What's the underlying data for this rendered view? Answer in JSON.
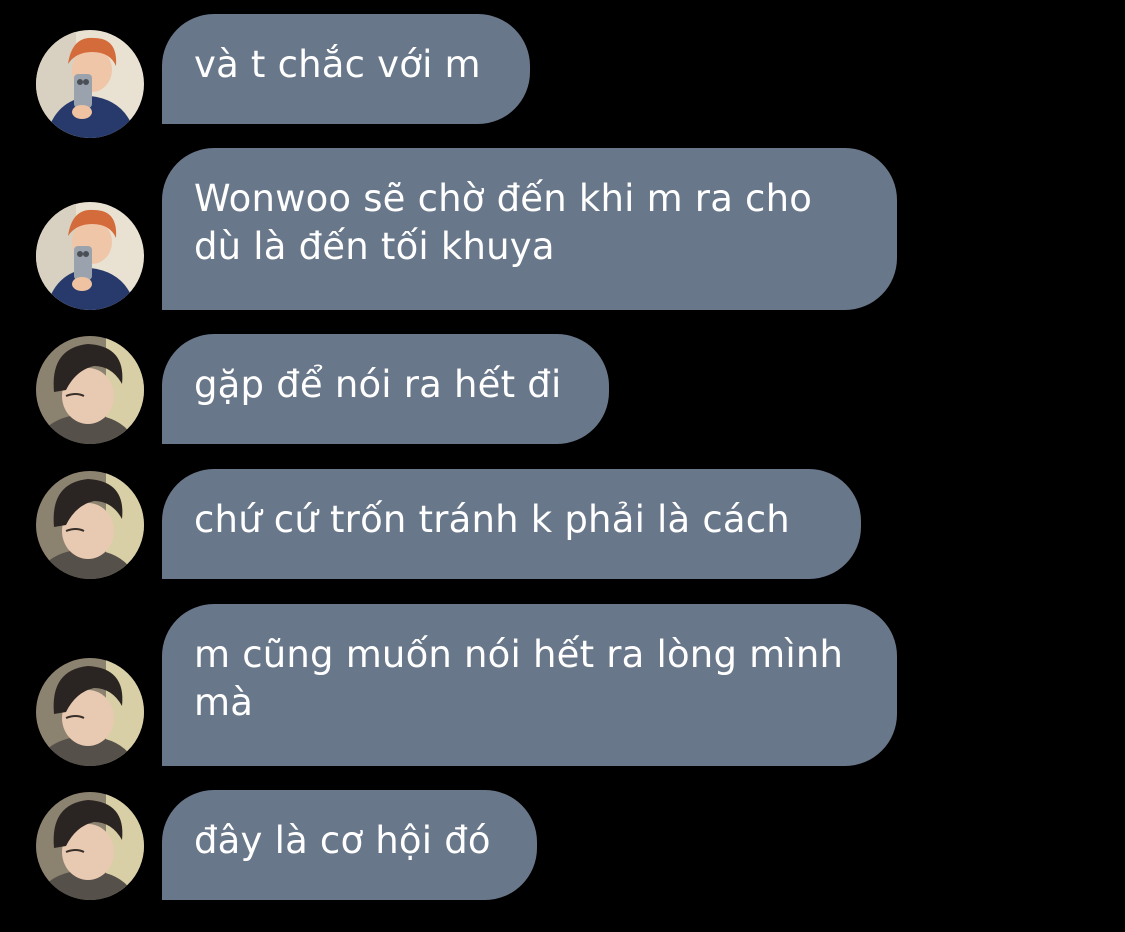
{
  "colors": {
    "background": "#000000",
    "bubble": "#69778a",
    "text": "#ffffff"
  },
  "messages": [
    {
      "avatar": "orange-hair-avatar",
      "text": "và t chắc với m"
    },
    {
      "avatar": "orange-hair-avatar",
      "text": "Wonwoo sẽ chờ đến khi m ra cho\ndù là đến tối khuya"
    },
    {
      "avatar": "dark-hair-avatar",
      "text": "gặp để nói ra hết đi"
    },
    {
      "avatar": "dark-hair-avatar",
      "text": "chứ cứ trốn tránh k phải là cách"
    },
    {
      "avatar": "dark-hair-avatar",
      "text": "m cũng muốn nói hết ra lòng mình\nmà"
    },
    {
      "avatar": "dark-hair-avatar",
      "text": "đây là cơ hội đó"
    }
  ]
}
